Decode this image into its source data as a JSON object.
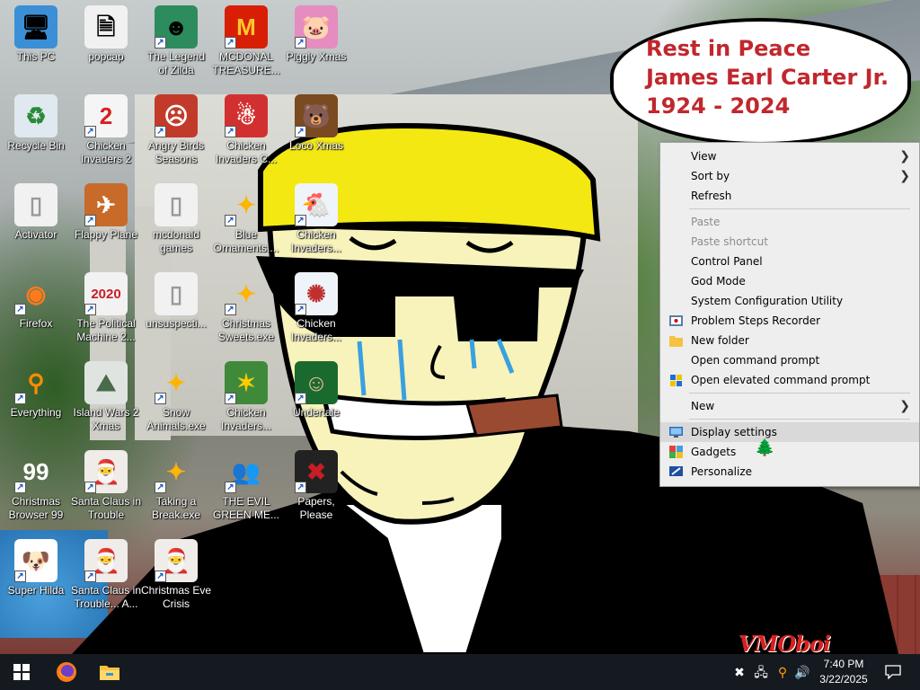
{
  "speech_bubble": {
    "lines": [
      "Rest in Peace",
      "James Earl Carter Jr.",
      "1924 - 2024"
    ],
    "color": "#c1272d"
  },
  "desktop_icons": [
    {
      "name": "this-pc",
      "label": [
        "This PC"
      ],
      "icon": "computer-icon",
      "shortcut": false
    },
    {
      "name": "popcap",
      "label": [
        "popcap"
      ],
      "icon": "folder-icon",
      "shortcut": false
    },
    {
      "name": "legend-of-zilda",
      "label": [
        "The Legend",
        "of Zilda"
      ],
      "icon": "game-icon",
      "shortcut": true
    },
    {
      "name": "mcdonald-treasure",
      "label": [
        "MCDONAL",
        "TREASURE..."
      ],
      "icon": "mcdonalds-icon",
      "shortcut": true
    },
    {
      "name": "piggly-xmas",
      "label": [
        "Piggly Xmas"
      ],
      "icon": "pig-icon",
      "shortcut": true
    },
    {
      "name": "recycle-bin",
      "label": [
        "Recycle Bin"
      ],
      "icon": "recycle-bin-icon",
      "shortcut": false
    },
    {
      "name": "chicken-invaders-2",
      "label": [
        "Chicken",
        "Invaders 2"
      ],
      "icon": "chicken-icon",
      "shortcut": true
    },
    {
      "name": "angry-birds-seasons",
      "label": [
        "Angry Birds",
        "Seasons"
      ],
      "icon": "angry-birds-icon",
      "shortcut": true
    },
    {
      "name": "chicken-invaders-c",
      "label": [
        "Chicken",
        "Invaders C..."
      ],
      "icon": "snowman-icon",
      "shortcut": true
    },
    {
      "name": "loco-xmas",
      "label": [
        "Loco Xmas"
      ],
      "icon": "bear-icon",
      "shortcut": true
    },
    {
      "name": "activator",
      "label": [
        "Activator"
      ],
      "icon": "file-icon",
      "shortcut": false
    },
    {
      "name": "flappy-plane",
      "label": [
        "Flappy Plane"
      ],
      "icon": "plane-icon",
      "shortcut": true
    },
    {
      "name": "mcdonald-games",
      "label": [
        "mcdonald",
        "games"
      ],
      "icon": "file-icon",
      "shortcut": false
    },
    {
      "name": "blue-ornaments",
      "label": [
        "Blue",
        "Ornaments...."
      ],
      "icon": "firework-icon",
      "shortcut": true
    },
    {
      "name": "chicken-invaders-a",
      "label": [
        "Chicken",
        "Invaders..."
      ],
      "icon": "chicken-santa-icon",
      "shortcut": true
    },
    {
      "name": "firefox",
      "label": [
        "Firefox"
      ],
      "icon": "firefox-icon",
      "shortcut": true
    },
    {
      "name": "political-machine",
      "label": [
        "The Political",
        "Machine 2..."
      ],
      "icon": "political-2020-icon",
      "shortcut": true
    },
    {
      "name": "unsuspecting",
      "label": [
        "unsuspecti..."
      ],
      "icon": "file-icon",
      "shortcut": false
    },
    {
      "name": "christmas-sweets",
      "label": [
        "Christmas",
        "Sweets.exe"
      ],
      "icon": "firework-icon",
      "shortcut": true
    },
    {
      "name": "chicken-invaders-b",
      "label": [
        "Chicken",
        "Invaders..."
      ],
      "icon": "chicken-ship-icon",
      "shortcut": true
    },
    {
      "name": "everything",
      "label": [
        "Everything"
      ],
      "icon": "magnifier-icon",
      "shortcut": true
    },
    {
      "name": "island-wars",
      "label": [
        "Island Wars 2",
        "Xmas"
      ],
      "icon": "island-icon",
      "shortcut": false
    },
    {
      "name": "snow-animals",
      "label": [
        "Snow",
        "Animals.exe"
      ],
      "icon": "firework-icon",
      "shortcut": true
    },
    {
      "name": "chicken-invaders-d",
      "label": [
        "Chicken",
        "Invaders..."
      ],
      "icon": "chicken-green-icon",
      "shortcut": true
    },
    {
      "name": "undertale",
      "label": [
        "Undertale"
      ],
      "icon": "undertale-icon",
      "shortcut": true
    },
    {
      "name": "christmas-browser",
      "label": [
        "Christmas",
        "Browser 99"
      ],
      "icon": "tree-99-icon",
      "shortcut": true
    },
    {
      "name": "santa-claus-trouble",
      "label": [
        "Santa Claus in",
        "Trouble"
      ],
      "icon": "santa-icon",
      "shortcut": true
    },
    {
      "name": "taking-a-break",
      "label": [
        "Taking a",
        "Break.exe"
      ],
      "icon": "firework-icon",
      "shortcut": true
    },
    {
      "name": "evil-green-messenger",
      "label": [
        "THE EVIL",
        "GREEN ME..."
      ],
      "icon": "messenger-icon",
      "shortcut": true
    },
    {
      "name": "papers-please",
      "label": [
        "Papers, Please"
      ],
      "icon": "papers-please-icon",
      "shortcut": true
    },
    {
      "name": "super-hilda",
      "label": [
        "Super Hilda"
      ],
      "icon": "dog-icon",
      "shortcut": true
    },
    {
      "name": "santa-claus-trouble-a",
      "label": [
        "Santa Claus in",
        "Trouble... A..."
      ],
      "icon": "santa-icon",
      "shortcut": true
    },
    {
      "name": "christmas-eve-crisis",
      "label": [
        "Christmas Eve",
        "Crisis"
      ],
      "icon": "santa-icon",
      "shortcut": true
    }
  ],
  "context_menu": {
    "items": [
      {
        "type": "item",
        "label": "View",
        "submenu": true
      },
      {
        "type": "item",
        "label": "Sort by",
        "submenu": true
      },
      {
        "type": "item",
        "label": "Refresh"
      },
      {
        "type": "sep"
      },
      {
        "type": "item",
        "label": "Paste",
        "disabled": true
      },
      {
        "type": "item",
        "label": "Paste shortcut",
        "disabled": true
      },
      {
        "type": "item",
        "label": "Control Panel"
      },
      {
        "type": "item",
        "label": "God Mode"
      },
      {
        "type": "item",
        "label": "System Configuration Utility"
      },
      {
        "type": "item",
        "label": "Problem Steps Recorder",
        "icon": "steps-recorder-icon"
      },
      {
        "type": "item",
        "label": "New folder",
        "icon": "folder-icon"
      },
      {
        "type": "item",
        "label": "Open command prompt"
      },
      {
        "type": "item",
        "label": "Open elevated command prompt",
        "icon": "shield-icon"
      },
      {
        "type": "sep"
      },
      {
        "type": "item",
        "label": "New",
        "submenu": true
      },
      {
        "type": "sep"
      },
      {
        "type": "item",
        "label": "Display settings",
        "icon": "display-icon",
        "highlight": true
      },
      {
        "type": "item",
        "label": "Gadgets",
        "icon": "gadgets-icon"
      },
      {
        "type": "item",
        "label": "Personalize",
        "icon": "personalize-icon"
      }
    ]
  },
  "taskbar": {
    "pinned": [
      {
        "name": "start-button",
        "icon": "windows-logo-icon"
      },
      {
        "name": "firefox-taskbar-button",
        "icon": "firefox-icon"
      },
      {
        "name": "file-explorer-taskbar-button",
        "icon": "folder-icon"
      }
    ],
    "clock": {
      "time": "7:40 PM",
      "date": "3/22/2025"
    }
  },
  "watermark": "VMOboi",
  "colors": {
    "taskbar": "#151a20",
    "menu_bg": "#eeeeee",
    "menu_highlight": "#d9d9d9",
    "accent": "#c1272d"
  }
}
